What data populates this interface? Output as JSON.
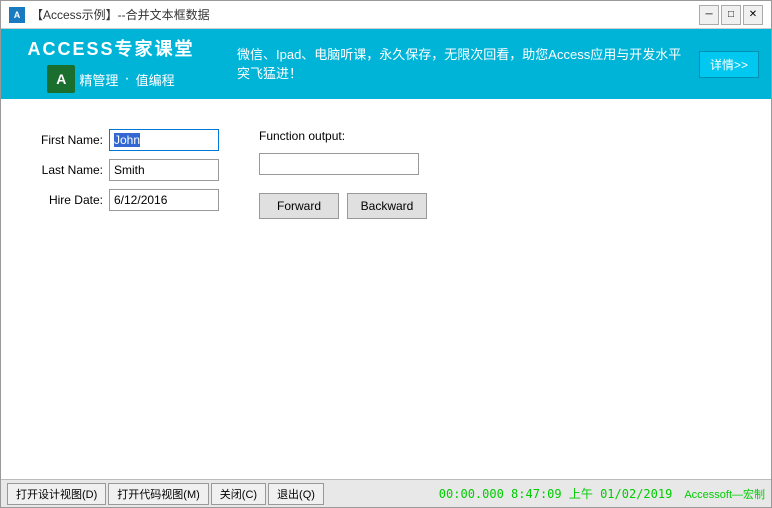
{
  "titleBar": {
    "icon": "A",
    "title": "【Access示例】--合并文本框数据",
    "closeBtn": "✕",
    "minBtn": "─",
    "maxBtn": "□"
  },
  "header": {
    "logoTitle": "ACCESS专家课堂",
    "logoIcon": "A",
    "subText1": "精管理",
    "subText2": "值编程",
    "adText": "微信、Ipad、电脑听课，永久保存，无限次回看，助您Access应用与开发水平突飞猛进！",
    "detailBtn": "详情>>"
  },
  "form": {
    "firstNameLabel": "First Name:",
    "lastNameLabel": "Last Name:",
    "hireDateLabel": "Hire Date:",
    "firstNameValue": "John",
    "lastNameValue": "Smith",
    "hireDateValue": "6/12/2016",
    "functionOutputLabel": "Function output:",
    "functionOutputValue": "",
    "forwardBtn": "Forward",
    "backwardBtn": "Backward"
  },
  "statusBar": {
    "designViewBtn": "打开设计视图(D)",
    "codeViewBtn": "打开代码视图(M)",
    "closeBtn": "关闭(C)",
    "exitBtn": "退出(Q)",
    "time": "00:00.000  8:47:09 上午  01/02/2019",
    "brand": "Accessoft—宏制"
  }
}
